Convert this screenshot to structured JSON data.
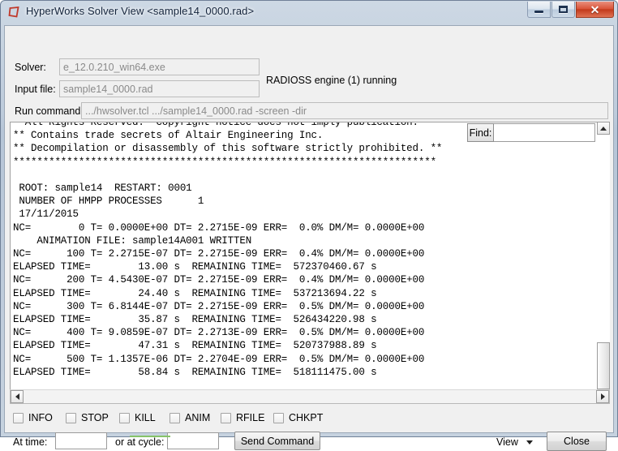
{
  "window": {
    "title": "HyperWorks Solver View <sample14_0000.rad>",
    "icon": "altair-hyperworks-icon",
    "controls": {
      "minimize": "minimize-button",
      "maximize": "maximize-button",
      "close": "close-button",
      "close_glyph": "✕"
    },
    "accent_close": "#c23a1c",
    "frame_color": "#b6c5d7"
  },
  "form": {
    "solver_label": "Solver:",
    "solver_value": "e_12.0.210_win64.exe",
    "input_file_label": "Input file:",
    "input_file_value": "sample14_0000.rad",
    "run_command_label": "Run command:",
    "run_command_value": ".../hwsolver.tcl .../sample14_0000.rad -screen -dir",
    "engine_status": "RADIOSS engine (1) running"
  },
  "find": {
    "button_label": "Find:",
    "input_value": "",
    "placeholder": ""
  },
  "log": {
    "text": "  All Rights Reserved.  Copyright notice does not imply publication.\n** Contains trade secrets of Altair Engineering Inc.\n** Decompilation or disassembly of this software strictly prohibited. **\n***********************************************************************\n\n ROOT: sample14  RESTART: 0001\n NUMBER OF HMPP PROCESSES      1\n 17/11/2015\nNC=        0 T= 0.0000E+00 DT= 2.2715E-09 ERR=  0.0% DM/M= 0.0000E+00\n    ANIMATION FILE: sample14A001 WRITTEN\nNC=      100 T= 2.2715E-07 DT= 2.2715E-09 ERR=  0.4% DM/M= 0.0000E+00\nELAPSED TIME=        13.00 s  REMAINING TIME=  572370460.67 s\nNC=      200 T= 4.5430E-07 DT= 2.2715E-09 ERR=  0.4% DM/M= 0.0000E+00\nELAPSED TIME=        24.40 s  REMAINING TIME=  537213694.22 s\nNC=      300 T= 6.8144E-07 DT= 2.2715E-09 ERR=  0.5% DM/M= 0.0000E+00\nELAPSED TIME=        35.87 s  REMAINING TIME=  526434220.98 s\nNC=      400 T= 9.0859E-07 DT= 2.2713E-09 ERR=  0.5% DM/M= 0.0000E+00\nELAPSED TIME=        47.31 s  REMAINING TIME=  520737988.89 s\nNC=      500 T= 1.1357E-06 DT= 2.2704E-09 ERR=  0.5% DM/M= 0.0000E+00\nELAPSED TIME=        58.84 s  REMAINING TIME=  518111475.00 s"
  },
  "checkboxes": [
    {
      "label": "INFO",
      "checked": false
    },
    {
      "label": "STOP",
      "checked": false
    },
    {
      "label": "KILL",
      "checked": false
    },
    {
      "label": "ANIM",
      "checked": false
    },
    {
      "label": "RFILE",
      "checked": false
    },
    {
      "label": "CHKPT",
      "checked": false
    }
  ],
  "bottom": {
    "at_time_label": "At time:",
    "at_time_value": "",
    "at_cycle_label": "or at cycle:",
    "at_cycle_value": "",
    "send_command_label": "Send Command",
    "view_label": "View",
    "close_label": "Close"
  }
}
